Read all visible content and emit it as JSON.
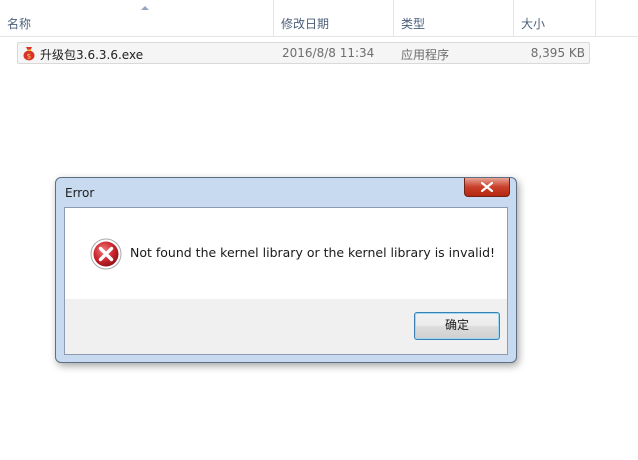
{
  "explorer": {
    "columns": [
      {
        "label": "名称"
      },
      {
        "label": "修改日期"
      },
      {
        "label": "类型"
      },
      {
        "label": "大小"
      }
    ],
    "files": [
      {
        "name": "升级包3.6.3.6.exe",
        "date": "2016/8/8 11:34",
        "type": "应用程序",
        "size": "8,395 KB",
        "icon": "money-bag-icon"
      }
    ]
  },
  "dialog": {
    "title": "Error",
    "message": "Not found the kernel library or the kernel library is invalid!",
    "ok_label": "确定",
    "icon": "error-icon",
    "colors": {
      "error_red": "#c8232c",
      "titlebar": "#c7daf0",
      "close_button": "#c9402a"
    }
  }
}
